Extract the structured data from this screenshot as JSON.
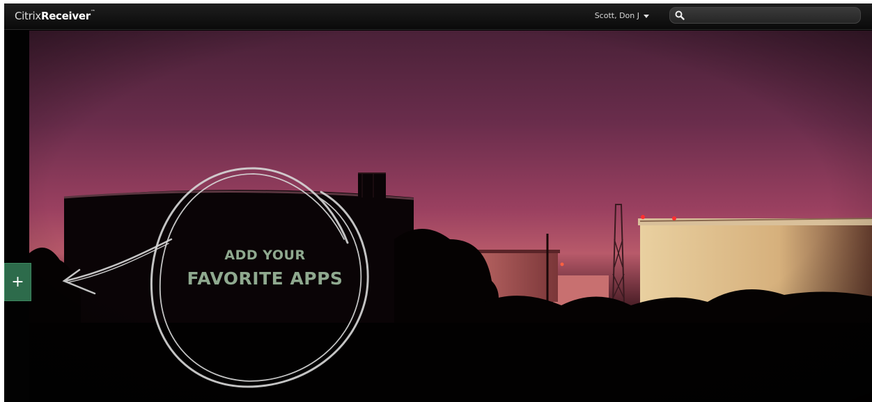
{
  "header": {
    "brand_light": "Citrix",
    "brand_bold": "Receiver",
    "brand_tm": "™",
    "user_name": "Scott, Don J",
    "search_placeholder": ""
  },
  "main": {
    "add_button_label": "+",
    "promo_line1": "ADD YOUR",
    "promo_line2": "FAVORITE APPS"
  },
  "colors": {
    "accent_green": "#2d6b4b",
    "promo_text": "#8fa98f",
    "sky_top": "#4a2138",
    "sky_glow": "#b85a6a"
  },
  "icons": [
    "search-icon",
    "caret-down-icon",
    "plus-icon",
    "chalk-arrow-icon"
  ]
}
